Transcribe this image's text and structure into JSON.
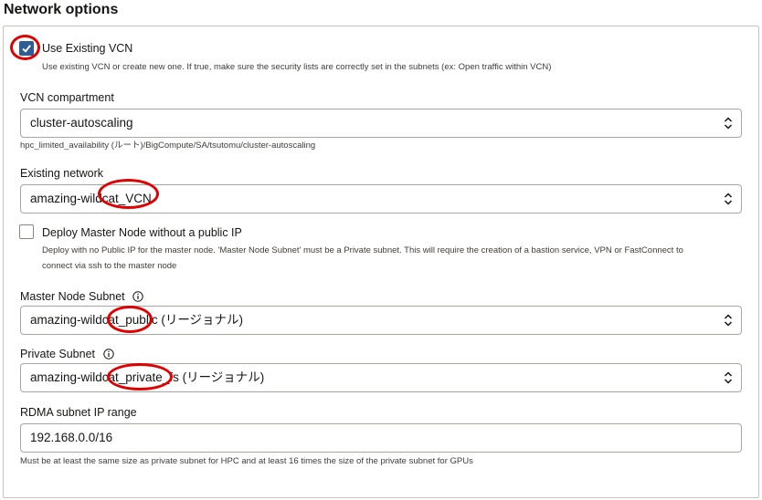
{
  "section_title": "Network options",
  "use_existing_vcn": {
    "label": "Use Existing VCN",
    "checked": true,
    "help": "Use existing VCN or create new one. If true, make sure the security lists are correctly set in the subnets (ex: Open traffic within VCN)"
  },
  "vcn_compartment": {
    "label": "VCN compartment",
    "value": "cluster-autoscaling",
    "path": "hpc_limited_availability (ルート)/BigCompute/SA/tsutomu/cluster-autoscaling"
  },
  "existing_network": {
    "label": "Existing network",
    "value": "amazing-wildcat_VCN"
  },
  "deploy_master_no_public_ip": {
    "label": "Deploy Master Node without a public IP",
    "checked": false,
    "help_line1": "Deploy with no Public IP for the master node. 'Master Node Subnet' must be a Private subnet. This will require the creation of a bastion service, VPN or FastConnect to",
    "help_line2": "connect via ssh to the master node"
  },
  "master_node_subnet": {
    "label": "Master Node Subnet",
    "value": "amazing-wildcat_public (リージョナル)"
  },
  "private_subnet": {
    "label": "Private Subnet",
    "value": "amazing-wildcat_private_fs (リージョナル)"
  },
  "rdma_subnet": {
    "label": "RDMA subnet IP range",
    "value": "192.168.0.0/16",
    "help": "Must be at least the same size as private subnet for HPC and at least 16 times the size of the private subnet for GPUs"
  },
  "colors": {
    "accent": "#2e5c97",
    "annotation": "#e00000"
  }
}
